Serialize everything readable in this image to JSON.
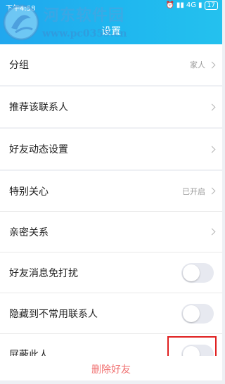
{
  "status": {
    "time": "下午4:58",
    "alarm_icon": "alarm-icon",
    "signal": "4G",
    "battery": "17"
  },
  "header": {
    "title": "设置",
    "accent": "#1fb2ee"
  },
  "watermark": {
    "line1": "河东软件园",
    "line2": "www.pc0359.cn"
  },
  "sections": {
    "group": {
      "label": "分组",
      "value": "家人"
    },
    "recommend": {
      "label": "推荐该联系人"
    },
    "moments": {
      "label": "好友动态设置"
    },
    "special": {
      "label": "特别关心",
      "value": "已开启"
    },
    "intimate": {
      "label": "亲密关系"
    },
    "mute": {
      "label": "好友消息免打扰",
      "on": false
    },
    "hide": {
      "label": "隐藏到不常用联系人",
      "on": false
    },
    "block": {
      "label": "屏蔽此人",
      "on": false
    }
  },
  "delete_label": "删除好友",
  "colors": {
    "highlight": "#e02020",
    "delete_text": "#f07070",
    "background": "#eef0f4"
  }
}
